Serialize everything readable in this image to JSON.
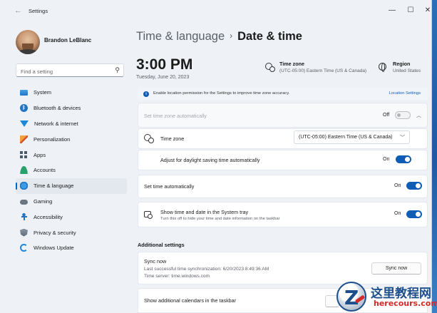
{
  "window": {
    "title": "Settings"
  },
  "user": {
    "name": "Brandon LeBlanc"
  },
  "search": {
    "placeholder": "Find a setting"
  },
  "sidebar": {
    "items": [
      {
        "label": "System",
        "icon": "system-icon"
      },
      {
        "label": "Bluetooth & devices",
        "icon": "bluetooth-icon"
      },
      {
        "label": "Network & internet",
        "icon": "wifi-icon"
      },
      {
        "label": "Personalization",
        "icon": "paintbrush-icon"
      },
      {
        "label": "Apps",
        "icon": "apps-icon"
      },
      {
        "label": "Accounts",
        "icon": "person-icon"
      },
      {
        "label": "Time & language",
        "icon": "globe-clock-icon",
        "active": true
      },
      {
        "label": "Gaming",
        "icon": "gamepad-icon"
      },
      {
        "label": "Accessibility",
        "icon": "accessibility-icon"
      },
      {
        "label": "Privacy & security",
        "icon": "shield-icon"
      },
      {
        "label": "Windows Update",
        "icon": "update-icon"
      }
    ]
  },
  "breadcrumb": {
    "parent": "Time & language",
    "separator": "›",
    "current": "Date & time"
  },
  "clock": {
    "time": "3:00 PM",
    "date": "Tuesday, June 20, 2023"
  },
  "summary": {
    "timezone_label": "Time zone",
    "timezone_value": "(UTC-05:00) Eastern Time (US & Canada)",
    "region_label": "Region",
    "region_value": "United States"
  },
  "info_bar": {
    "text": "Enable location permission for the Settings to improve time zone accuracy.",
    "link": "Location Settings"
  },
  "settings": {
    "auto_timezone": {
      "label": "Set time zone automatically",
      "state_text": "Off",
      "on": false
    },
    "timezone": {
      "label": "Time zone",
      "value": "(UTC-05:00) Eastern Time (US & Canada)"
    },
    "dst": {
      "label": "Adjust for daylight saving time automatically",
      "state_text": "On",
      "on": true
    },
    "auto_time": {
      "label": "Set time automatically",
      "state_text": "On",
      "on": true
    },
    "systray": {
      "label": "Show time and date in the System tray",
      "sub": "Turn this off to hide your time and date information on the taskbar",
      "state_text": "On",
      "on": true
    }
  },
  "additional": {
    "heading": "Additional settings",
    "sync": {
      "title": "Sync now",
      "last_sync": "Last successful time synchronization: 6/20/2023 8:49:36 AM",
      "server": "Time server: time.windows.com",
      "button": "Sync now"
    },
    "calendars": {
      "label": "Show additional calendars in the taskbar"
    }
  },
  "watermark": {
    "cn": "这里教程网",
    "en": "herecours.com"
  },
  "colors": {
    "accent": "#0f5cb6",
    "window_bg": "#eef2f7",
    "card_bg": "#ffffff"
  }
}
